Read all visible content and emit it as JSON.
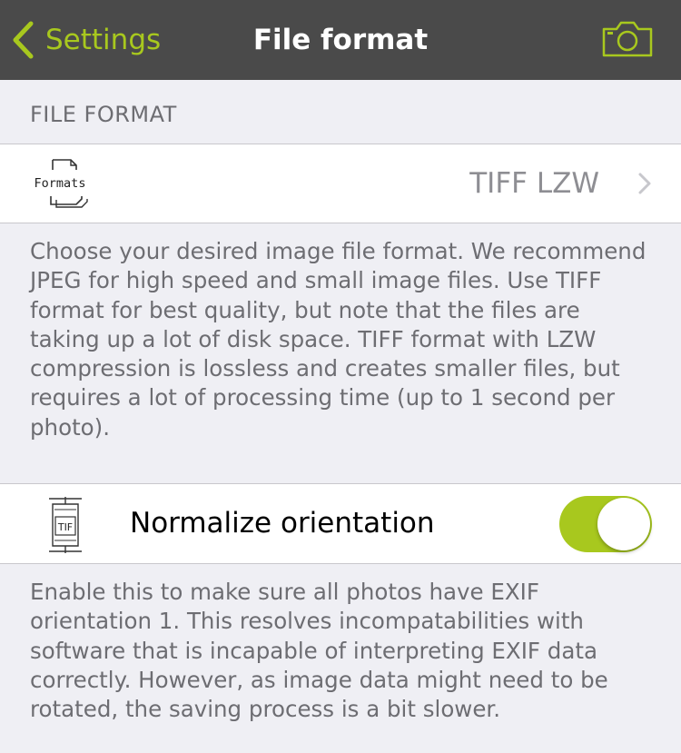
{
  "navbar": {
    "back_label": "Settings",
    "title": "File format",
    "back_icon": "chevron-left-icon",
    "right_icon": "camera-icon",
    "accent_color": "#a8c81e",
    "background_color": "#4a4a4a"
  },
  "file_format_section": {
    "header": "FILE FORMAT",
    "icon_label": "Formats",
    "value": "TIFF LZW",
    "description": "Choose your desired image file format. We recommend JPEG for high speed and small image files. Use TIFF format for best quality, but note that the files are taking up a lot of disk space. TIFF format with LZW compression is lossless and creates smaller files, but requires a lot of processing time (up to 1 second per photo)."
  },
  "normalize_section": {
    "icon_label": "TIF",
    "label": "Normalize orientation",
    "toggle_on": true,
    "description": "Enable this to make sure all photos have EXIF orientation 1. This resolves incompatabilities with software that is incapable of interpreting EXIF data correctly. However, as image data might need to be rotated, the saving process is a bit slower."
  }
}
